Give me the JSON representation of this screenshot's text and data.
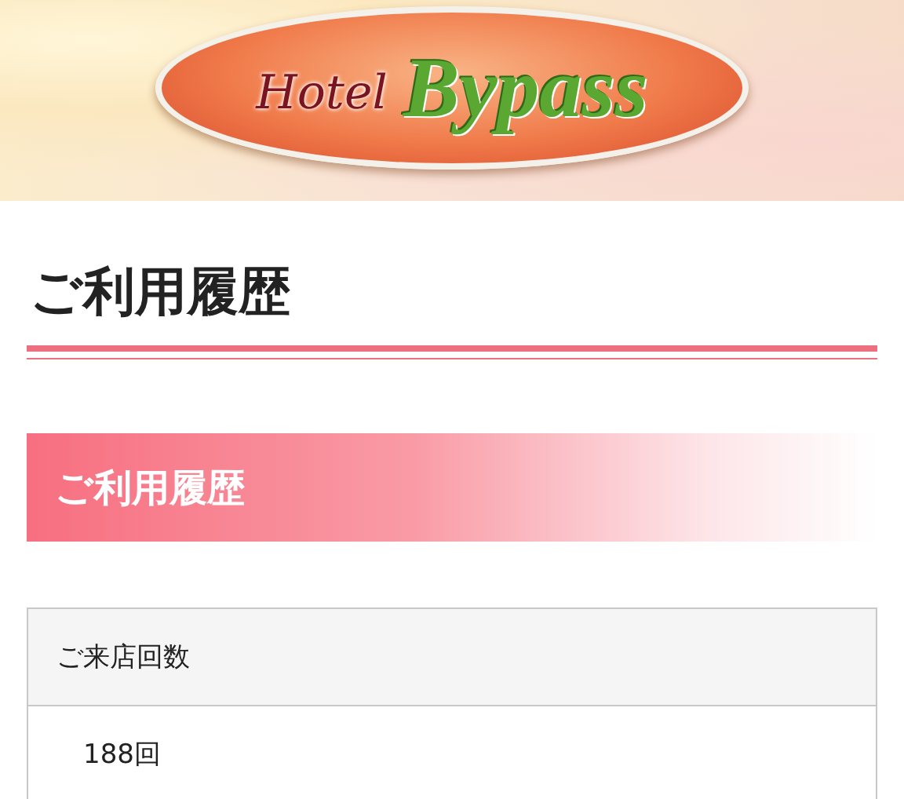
{
  "logo": {
    "word_1": "Hotel",
    "word_2": "Bypass"
  },
  "page_title": "ご利用履歴",
  "section": {
    "heading": "ご利用履歴"
  },
  "table": {
    "header": "ご来店回数",
    "value": "188回"
  }
}
